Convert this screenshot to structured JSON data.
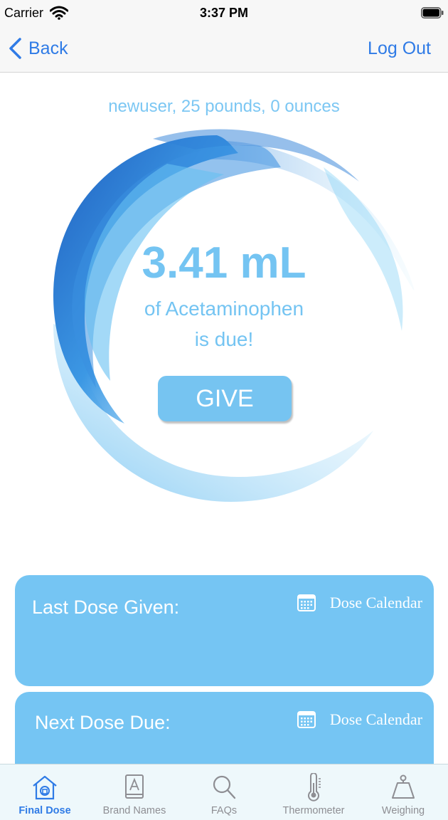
{
  "status_bar": {
    "carrier": "Carrier",
    "time": "3:37 PM"
  },
  "nav": {
    "back_label": "Back",
    "logout_label": "Log Out"
  },
  "user_info": "newuser, 25 pounds, 0 ounces",
  "dose": {
    "amount": "3.41 mL",
    "medication_line": "of Acetaminophen",
    "due_line": "is due!",
    "give_label": "GIVE"
  },
  "cards": {
    "last": {
      "title": "Last Dose Given:",
      "calendar_label": "Dose Calendar"
    },
    "next": {
      "title": "Next Dose Due:",
      "calendar_label": "Dose Calendar"
    }
  },
  "tabs": [
    {
      "label": "Final Dose",
      "icon": "house-icon",
      "active": true
    },
    {
      "label": "Brand Names",
      "icon": "book-icon",
      "active": false
    },
    {
      "label": "FAQs",
      "icon": "search-icon",
      "active": false
    },
    {
      "label": "Thermometer",
      "icon": "thermometer-icon",
      "active": false
    },
    {
      "label": "Weighing",
      "icon": "scale-icon",
      "active": false
    }
  ],
  "colors": {
    "accent": "#2f7be6",
    "card_blue": "#75c5f3",
    "text_blue": "#74c4f2",
    "inactive_tab": "#8e8e93"
  }
}
